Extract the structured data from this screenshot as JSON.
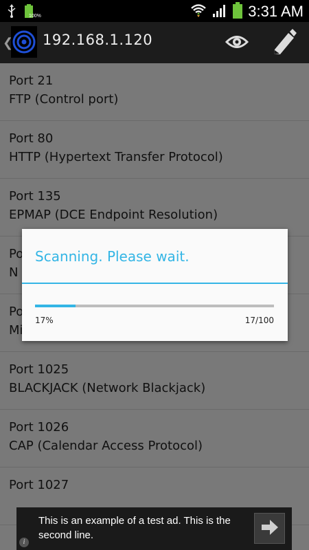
{
  "status_bar": {
    "time": "3:31 AM",
    "battery_small_pct": "100%",
    "icons": [
      "usb-icon",
      "battery-icon",
      "wifi-icon",
      "signal-icon",
      "battery-icon"
    ]
  },
  "action_bar": {
    "title": "192.168.1.120",
    "back_glyph": "❮",
    "actions": [
      "eye-icon",
      "pencil-icon"
    ]
  },
  "ports": [
    {
      "port": "Port  21",
      "service": "FTP (Control port)"
    },
    {
      "port": "Port  80",
      "service": "HTTP (Hypertext Transfer Protocol)"
    },
    {
      "port": "Port  135",
      "service": "EPMAP (DCE Endpoint Resolution)"
    },
    {
      "port": "Po",
      "service": "N"
    },
    {
      "port": "Po",
      "service": "Mi"
    },
    {
      "port": "Port  1025",
      "service": "BLACKJACK (Network Blackjack)"
    },
    {
      "port": "Port  1026",
      "service": "CAP (Calendar Access Protocol)"
    },
    {
      "port": "Port  1027",
      "service": ""
    }
  ],
  "dialog": {
    "title": "Scanning. Please wait.",
    "progress_fraction": 0.17,
    "percent_label": "17%",
    "count_label": "17/100"
  },
  "ad": {
    "text": "This is an example of a test ad. This is the second line.",
    "info_glyph": "i",
    "arrow_icon": "arrow-right-icon"
  },
  "colors": {
    "accent": "#33b5e5",
    "status_bar": "#000000",
    "action_bar": "#1c1c1c",
    "battery_green": "#6ec33b"
  }
}
